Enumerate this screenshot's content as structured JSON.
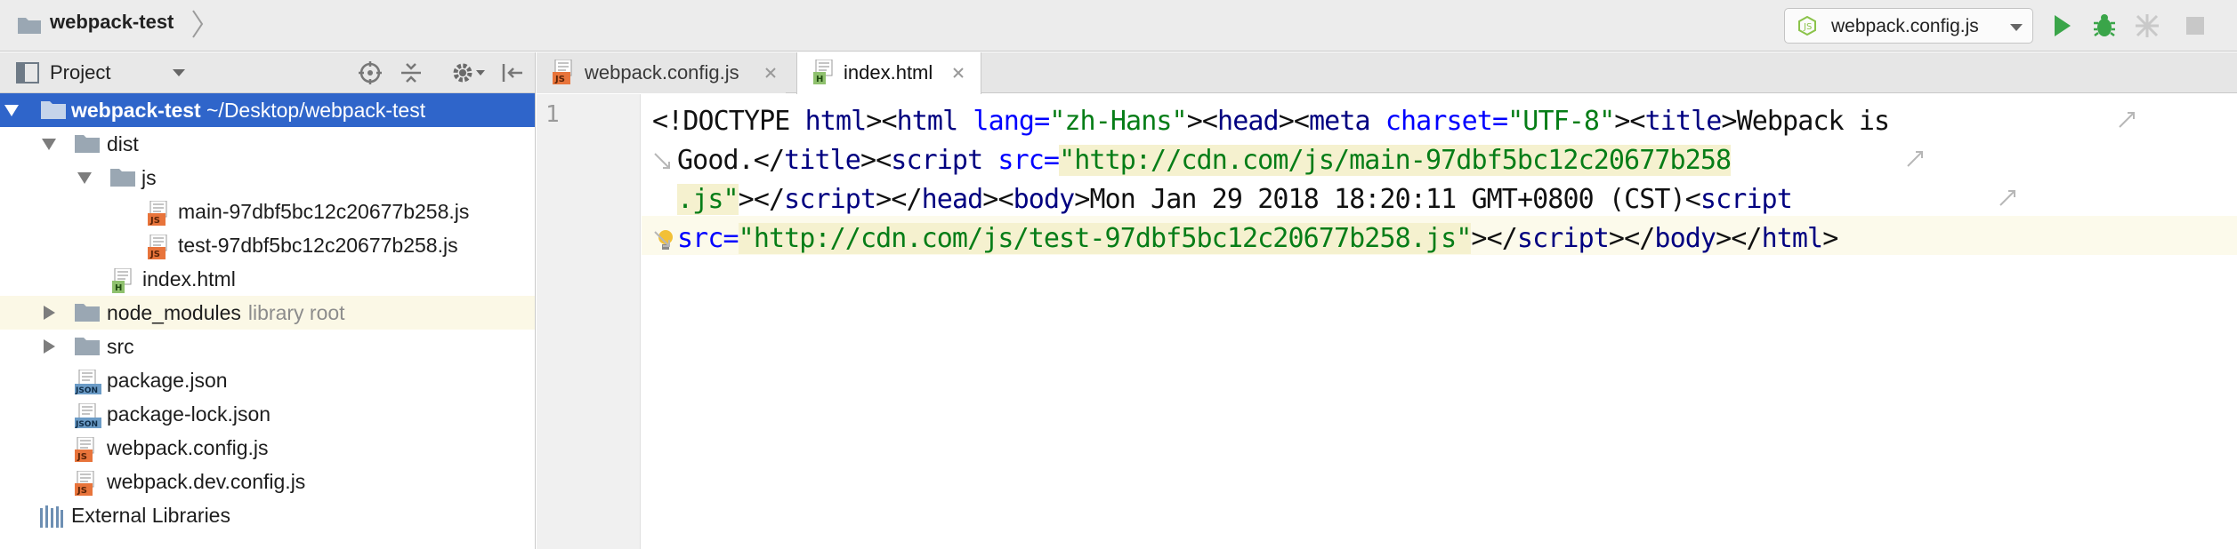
{
  "navbar": {
    "project_name": "webpack-test",
    "run_config": "webpack.config.js"
  },
  "project_panel": {
    "title": "Project",
    "tree": [
      {
        "label": "webpack-test",
        "suffix": "~/Desktop/webpack-test",
        "kind": "folder",
        "expanded": true,
        "selected": true
      },
      {
        "label": "dist",
        "kind": "folder",
        "expanded": true
      },
      {
        "label": "js",
        "kind": "folder",
        "expanded": true
      },
      {
        "label": "main-97dbf5bc12c20677b258.js",
        "kind": "js"
      },
      {
        "label": "test-97dbf5bc12c20677b258.js",
        "kind": "js"
      },
      {
        "label": "index.html",
        "kind": "html"
      },
      {
        "label": "node_modules",
        "suffix": "library root",
        "kind": "folder",
        "expanded": false
      },
      {
        "label": "src",
        "kind": "folder",
        "expanded": false
      },
      {
        "label": "package.json",
        "kind": "json"
      },
      {
        "label": "package-lock.json",
        "kind": "json"
      },
      {
        "label": "webpack.config.js",
        "kind": "js"
      },
      {
        "label": "webpack.dev.config.js",
        "kind": "js"
      },
      {
        "label": "External Libraries",
        "kind": "library"
      }
    ],
    "icon_badges": {
      "js": "JS",
      "json": "JSON",
      "html": "H"
    }
  },
  "editor": {
    "tabs": [
      {
        "label": "webpack.config.js",
        "active": false
      },
      {
        "label": "index.html",
        "active": true
      }
    ],
    "line_number": "1",
    "code": {
      "l1": {
        "a": "<!DOCTYPE ",
        "b": "html",
        "c": "><",
        "d": "html ",
        "e": "lang=",
        "f": "\"zh-Hans\"",
        "g": "><",
        "h": "head",
        "i": "><",
        "j": "meta ",
        "k": "charset=",
        "l": "\"UTF-8\"",
        "m": "><",
        "n": "title",
        "o": ">Webpack is"
      },
      "l2": {
        "a": "Good.</",
        "b": "title",
        "c": "><",
        "d": "script ",
        "e": "src=",
        "f": "\"http://cdn.com/js/main-97dbf5bc12c20677b258"
      },
      "l3": {
        "a": ".js\"",
        "b": "></",
        "c": "script",
        "d": "></",
        "e": "head",
        "f": "><",
        "g": "body",
        "h": ">Mon Jan 29 2018 18:20:11 GMT+0800 (CST)<",
        "i": "script "
      },
      "l4": {
        "a": "src=",
        "b": "\"http://cdn.com/js/test-97dbf5bc12c20677b258.js\"",
        "c": "></",
        "d": "script",
        "e": "></",
        "f": "body",
        "g": "></",
        "h": "html",
        "i": ">"
      }
    }
  }
}
